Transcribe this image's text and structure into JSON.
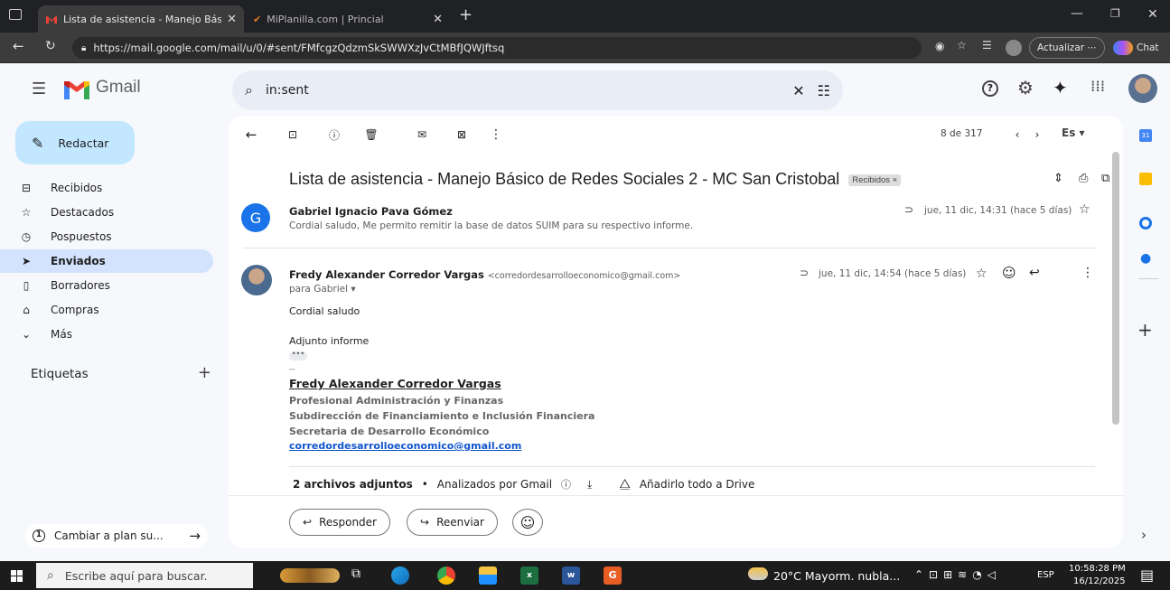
{
  "browser": {
    "tabs": [
      {
        "title": "Lista de asistencia - Manejo Básico",
        "active": true
      },
      {
        "title": "MiPlanilla.com | Princial",
        "active": false
      }
    ],
    "url": "https://mail.google.com/mail/u/0/#sent/FMfcgzQdzmSkSWWXzJvCtMBfJQWJftsq",
    "update_label": "Actualizar ⋯",
    "chat_label": "Chat"
  },
  "gmail": {
    "brand": "Gmail",
    "search_value": "in:sent",
    "compose_label": "Redactar",
    "nav": [
      {
        "label": "Recibidos",
        "icon": "inbox-icon"
      },
      {
        "label": "Destacados",
        "icon": "star-icon"
      },
      {
        "label": "Pospuestos",
        "icon": "clock-icon"
      },
      {
        "label": "Enviados",
        "icon": "send-icon",
        "active": true
      },
      {
        "label": "Borradores",
        "icon": "draft-icon"
      },
      {
        "label": "Compras",
        "icon": "shopping-icon"
      },
      {
        "label": "Más",
        "icon": "chevron-down-icon"
      }
    ],
    "labels_heading": "Etiquetas",
    "plan_label": "Cambiar a plan su...",
    "pagination": "8 de 317",
    "lang_label": "Es"
  },
  "thread": {
    "subject": "Lista de asistencia - Manejo Básico de Redes Sociales 2 - MC San Cristobal",
    "chip": "Recibidos ×",
    "messages": [
      {
        "sender": "Gabriel Ignacio Pava Gómez",
        "avatar_letter": "G",
        "snippet": "Cordial saludo, Me permito remitir la base de datos SUIM para su respectivo informe.",
        "date": "jue, 11 dic, 14:31 (hace 5 días)"
      },
      {
        "sender": "Fredy Alexander Corredor Vargas",
        "email": "<corredordesarrolloeconomico@gmail.com>",
        "to": "para Gabriel",
        "date": "jue, 11 dic, 14:54 (hace 5 días)",
        "body": [
          "Cordial saludo",
          "Adjunto informe"
        ],
        "sig_dashes": "--",
        "sig_name": "Fredy Alexander Corredor Vargas",
        "sig_lines": [
          "Profesional Administración y Finanzas",
          "Subdirección de Financiamiento e Inclusión  Financiera",
          "Secretaria de Desarrollo Económico"
        ],
        "sig_email": "corredordesarrolloeconomico@gmail.com"
      }
    ],
    "attachments_label": "2 archivos adjuntos",
    "scanned_label": "Analizados por Gmail",
    "drive_label": "Añadirlo todo a Drive",
    "reply_label": "Responder",
    "forward_label": "Reenviar"
  },
  "taskbar": {
    "search_placeholder": "Escribe aquí para buscar.",
    "weather": "20°C  Mayorm. nubla...",
    "lang": "ESP",
    "time": "10:58:28 PM",
    "date": "16/12/2025"
  }
}
